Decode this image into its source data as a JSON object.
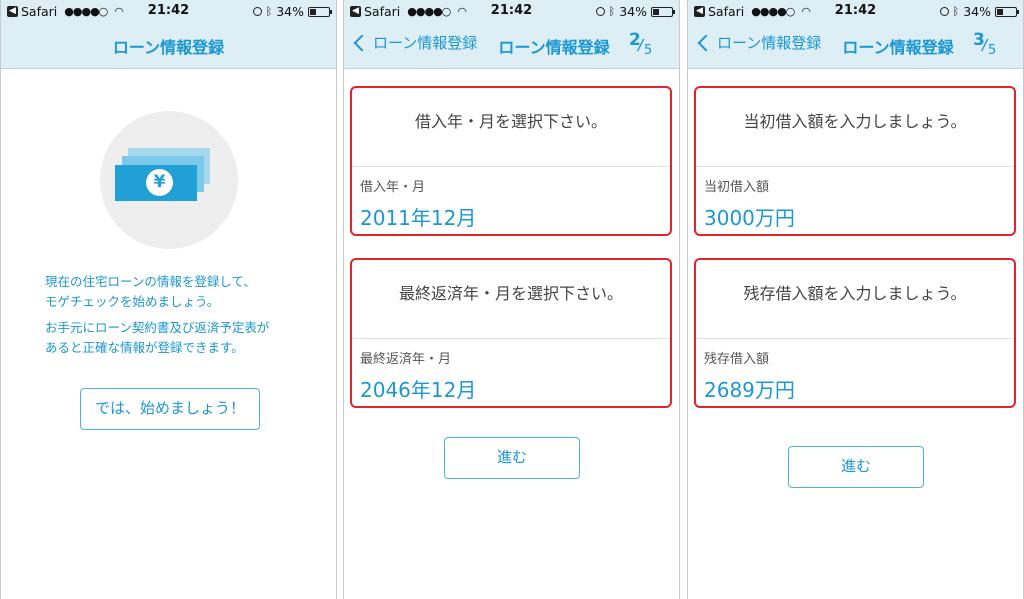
{
  "status_bar": {
    "back_app": "Safari",
    "signal": "●●●●○",
    "time": "21:42",
    "battery_percent": "34%",
    "battery_level": 0.34
  },
  "icons": {
    "back_app": "back-triangle-icon",
    "wifi": "wifi-icon",
    "orientation_lock": "rotation-lock-icon",
    "bluetooth": "bluetooth-icon",
    "battery": "battery-icon",
    "nav_back": "chevron-left-icon",
    "hero": "yen-banknotes-icon"
  },
  "colors": {
    "accent": "#1b97d4",
    "header_bg": "#ddeef5",
    "highlight_border": "#e0242b"
  },
  "screen1": {
    "title": "ローン情報登録",
    "intro_line1": "現在の住宅ローンの情報を登録して、\nモゲチェックを始めましょう。",
    "intro_line2": "お手元にローン契約書及び返済予定表が\nあると正確な情報が登録できます。",
    "start_button": "では、始めましょう！",
    "yen_symbol": "¥"
  },
  "screen2": {
    "back_label": "ローン情報登録",
    "title": "ローン情報登録",
    "step_current": "2",
    "step_total": "5",
    "card1": {
      "question": "借入年・月を選択下さい。",
      "label": "借入年・月",
      "value": "2011年12月"
    },
    "card2": {
      "question": "最終返済年・月を選択下さい。",
      "label": "最終返済年・月",
      "value": "2046年12月"
    },
    "next_button": "進む"
  },
  "screen3": {
    "back_label": "ローン情報登録",
    "title": "ローン情報登録",
    "step_current": "3",
    "step_total": "5",
    "card1": {
      "question": "当初借入額を入力しましょう。",
      "label": "当初借入額",
      "value": "3000万円"
    },
    "card2": {
      "question": "残存借入額を入力しましょう。",
      "label": "残存借入額",
      "value": "2689万円"
    },
    "next_button": "進む"
  }
}
